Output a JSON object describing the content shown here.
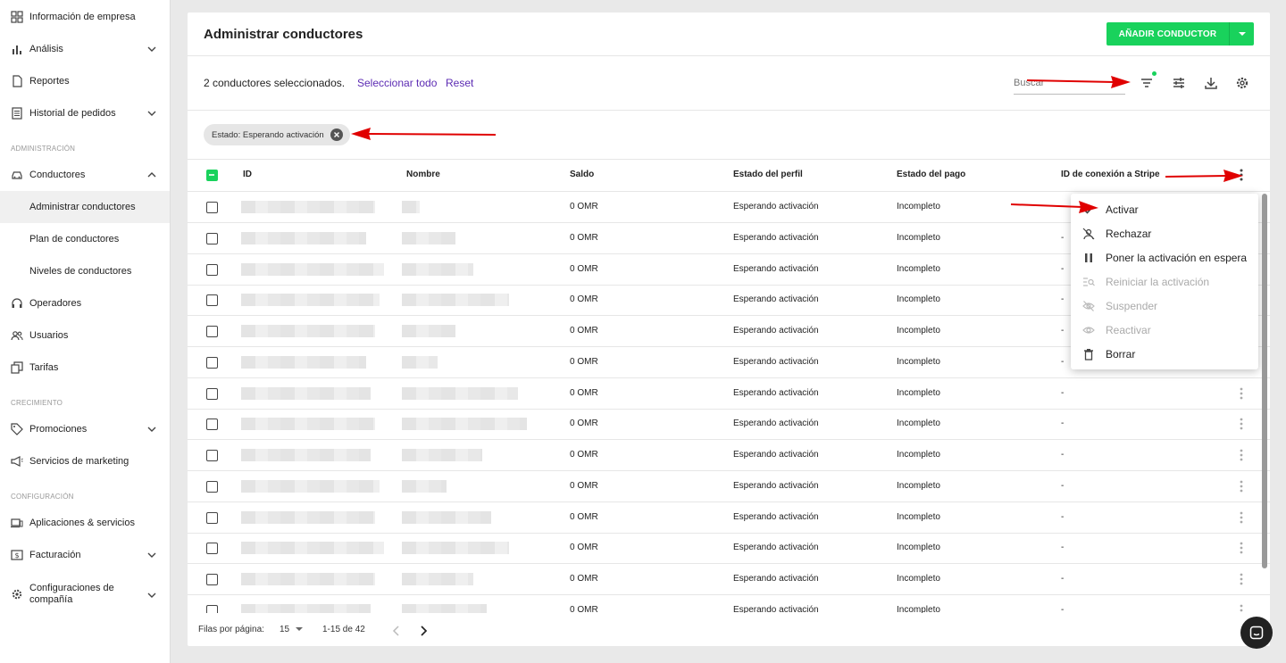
{
  "sidebar": {
    "items": [
      {
        "label": "Información de empresa"
      },
      {
        "label": "Análisis"
      },
      {
        "label": "Reportes"
      },
      {
        "label": "Historial de pedidos"
      },
      {
        "label": "Conductores"
      },
      {
        "label": "Administrar conductores"
      },
      {
        "label": "Plan de conductores"
      },
      {
        "label": "Niveles de conductores"
      },
      {
        "label": "Operadores"
      },
      {
        "label": "Usuarios"
      },
      {
        "label": "Tarifas"
      },
      {
        "label": "Promociones"
      },
      {
        "label": "Servicios de marketing"
      },
      {
        "label": "Aplicaciones & servicios"
      },
      {
        "label": "Facturación"
      },
      {
        "label": "Configuraciones de compañía"
      }
    ],
    "sections": {
      "admin": "ADMINISTRACIÓN",
      "growth": "CRECIMIENTO",
      "config": "CONFIGURACIÓN"
    }
  },
  "header": {
    "title": "Administrar conductores",
    "add_button": "AÑADIR CONDUCTOR"
  },
  "toolbar": {
    "selected_text": "2 conductores seleccionados.",
    "select_all": "Seleccionar todo",
    "reset": "Reset",
    "search_placeholder": "Buscar"
  },
  "filter_chip": "Estado: Esperando activación",
  "table": {
    "columns": [
      "ID",
      "Nombre",
      "Saldo",
      "Estado del perfil",
      "Estado del pago",
      "ID de conexión a Stripe"
    ],
    "rows": [
      {
        "saldo": "0 OMR",
        "perfil": "Esperando activación",
        "pago": "Incompleto",
        "stripe": "-"
      },
      {
        "saldo": "0 OMR",
        "perfil": "Esperando activación",
        "pago": "Incompleto",
        "stripe": "-"
      },
      {
        "saldo": "0 OMR",
        "perfil": "Esperando activación",
        "pago": "Incompleto",
        "stripe": "-"
      },
      {
        "saldo": "0 OMR",
        "perfil": "Esperando activación",
        "pago": "Incompleto",
        "stripe": "-"
      },
      {
        "saldo": "0 OMR",
        "perfil": "Esperando activación",
        "pago": "Incompleto",
        "stripe": "-"
      },
      {
        "saldo": "0 OMR",
        "perfil": "Esperando activación",
        "pago": "Incompleto",
        "stripe": "-"
      },
      {
        "saldo": "0 OMR",
        "perfil": "Esperando activación",
        "pago": "Incompleto",
        "stripe": "-"
      },
      {
        "saldo": "0 OMR",
        "perfil": "Esperando activación",
        "pago": "Incompleto",
        "stripe": "-"
      },
      {
        "saldo": "0 OMR",
        "perfil": "Esperando activación",
        "pago": "Incompleto",
        "stripe": "-"
      },
      {
        "saldo": "0 OMR",
        "perfil": "Esperando activación",
        "pago": "Incompleto",
        "stripe": "-"
      },
      {
        "saldo": "0 OMR",
        "perfil": "Esperando activación",
        "pago": "Incompleto",
        "stripe": "-"
      },
      {
        "saldo": "0 OMR",
        "perfil": "Esperando activación",
        "pago": "Incompleto",
        "stripe": "-"
      },
      {
        "saldo": "0 OMR",
        "perfil": "Esperando activación",
        "pago": "Incompleto",
        "stripe": "-"
      },
      {
        "saldo": "0 OMR",
        "perfil": "Esperando activación",
        "pago": "Incompleto",
        "stripe": "-"
      }
    ]
  },
  "menu": {
    "items": [
      {
        "label": "Activar"
      },
      {
        "label": "Rechazar"
      },
      {
        "label": "Poner la activación en espera"
      },
      {
        "label": "Reiniciar la activación"
      },
      {
        "label": "Suspender"
      },
      {
        "label": "Reactivar"
      },
      {
        "label": "Borrar"
      }
    ]
  },
  "footer": {
    "rows_label": "Filas por página:",
    "rows_value": "15",
    "range": "1-15 de 42"
  },
  "colors": {
    "accent": "#19d25c",
    "link": "#5c2bb3",
    "arrow": "#e00000"
  }
}
